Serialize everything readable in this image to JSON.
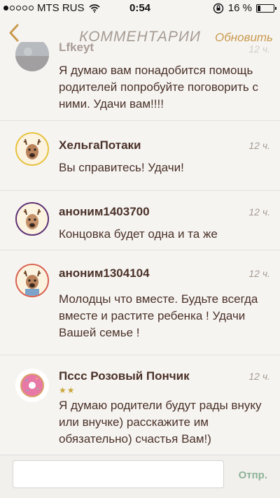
{
  "status_bar": {
    "carrier": "MTS RUS",
    "time": "0:54",
    "battery": "16 %",
    "battery_level": 0.16,
    "signal_bars_filled": 1,
    "signal_bars_total": 5
  },
  "nav": {
    "title": "КОММЕНТАРИИ",
    "refresh_label": "Обновить"
  },
  "comments": [
    {
      "author": "Lfkeyt",
      "time": "12 ч.",
      "text": "Я думаю вам понадобится помощь родителей попробуйте поговорить с ними. Удачи вам!!!!",
      "avatar": "photo-avatar"
    },
    {
      "author": "ХельгаПотаки",
      "time": "12 ч.",
      "text": "Вы справитесь! Удачи!",
      "avatar": "deer-avatar",
      "ring_color": "#e6c13b"
    },
    {
      "author": "аноним1403700",
      "time": "12 ч.",
      "text": "Концовка будет одна и та же",
      "avatar": "deer-avatar",
      "ring_color": "#5c2f73"
    },
    {
      "author": "аноним1304104",
      "time": "12 ч.",
      "text": "Молодцы что вместе. Будьте всегда вместе и растите ребенка ! Удачи Вашей семье !",
      "avatar": "deer-avatar",
      "ring_color": "#d85f4c"
    },
    {
      "author": "Пссс Розовый Пончик",
      "time": "12 ч.",
      "text": "Я думаю родители будут рады внуку или внучке) расскажите им обязательно) счастья Вам!)",
      "avatar": "donut-avatar",
      "stars": "★★",
      "star_rating": 2
    }
  ],
  "composer": {
    "value": "",
    "send_label": "Отпр."
  },
  "colors": {
    "background": "#f6f4f1",
    "text": "#4a3128",
    "accent": "#c99a4e",
    "send": "#8db398",
    "muted": "#a59b92"
  }
}
